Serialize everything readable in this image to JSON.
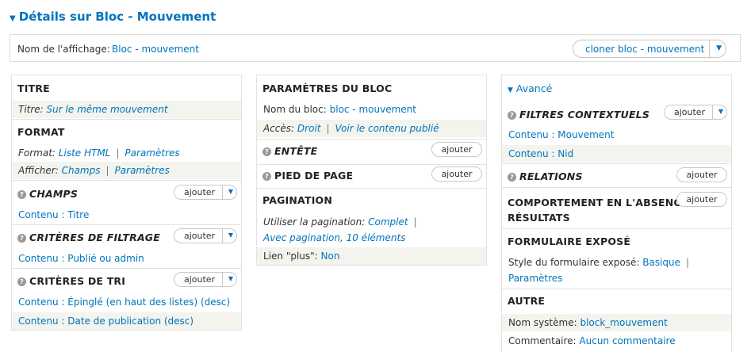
{
  "header": {
    "title": "Détails sur Bloc - Mouvement"
  },
  "display_bar": {
    "label": "Nom de l'affichage:",
    "name": "Bloc - mouvement",
    "clone_label": "cloner bloc - mouvement"
  },
  "col1": {
    "titre": {
      "heading": "TITRE",
      "label": "Titre:",
      "value": "Sur le même mouvement"
    },
    "format": {
      "heading": "FORMAT",
      "format_label": "Format:",
      "format_value": "Liste HTML",
      "format_params": "Paramètres",
      "show_label": "Afficher:",
      "show_value": "Champs",
      "show_params": "Paramètres"
    },
    "champs": {
      "heading": "CHAMPS",
      "add": "ajouter",
      "items": [
        "Contenu : Titre"
      ]
    },
    "filtrage": {
      "heading": "CRITÈRES DE FILTRAGE",
      "add": "ajouter",
      "items": [
        "Contenu : Publié ou admin"
      ]
    },
    "tri": {
      "heading": "CRITÈRES DE TRI",
      "add": "ajouter",
      "items": [
        "Contenu : Épinglé (en haut des listes) (desc)",
        "Contenu : Date de publication (desc)"
      ]
    }
  },
  "col2": {
    "block": {
      "heading": "PARAMÈTRES DU BLOC",
      "name_label": "Nom du bloc:",
      "name_value": "bloc - mouvement",
      "access_label": "Accès:",
      "access_value": "Droit",
      "access_extra": "Voir le contenu publié"
    },
    "entete": {
      "heading": "ENTÊTE",
      "add": "ajouter"
    },
    "pied": {
      "heading": "PIED DE PAGE",
      "add": "ajouter"
    },
    "pagination": {
      "heading": "PAGINATION",
      "use_label": "Utiliser la pagination:",
      "use_value": "Complet",
      "detail": "Avec pagination, 10 éléments",
      "more_label": "Lien \"plus\":",
      "more_value": "Non"
    }
  },
  "col3": {
    "advanced": "Avancé",
    "filtres": {
      "heading": "FILTRES CONTEXTUELS",
      "add": "ajouter",
      "items": [
        "Contenu : Mouvement",
        "Contenu : Nid"
      ]
    },
    "relations": {
      "heading": "RELATIONS",
      "add": "ajouter"
    },
    "absence": {
      "heading_line1": "COMPORTEMENT EN L'ABSENCE DE",
      "heading_line2": "RÉSULTATS",
      "add": "ajouter"
    },
    "expose": {
      "heading": "FORMULAIRE EXPOSÉ",
      "style_label": "Style du formulaire exposé:",
      "style_value": "Basique",
      "style_params": "Paramètres"
    },
    "autre": {
      "heading": "AUTRE",
      "sys_label": "Nom système:",
      "sys_value": "block_mouvement",
      "comment_label": "Commentaire:",
      "comment_value": "Aucun commentaire"
    }
  }
}
